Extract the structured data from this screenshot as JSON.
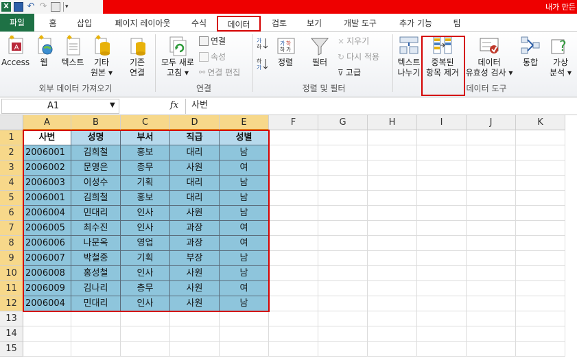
{
  "titlebar": {
    "title_text": "내가 만든"
  },
  "tabs": [
    {
      "label": "파일"
    },
    {
      "label": "홈"
    },
    {
      "label": "삽입"
    },
    {
      "label": "페이지 레이아웃"
    },
    {
      "label": "수식"
    },
    {
      "label": "데이터"
    },
    {
      "label": "검토"
    },
    {
      "label": "보기"
    },
    {
      "label": "개발 도구"
    },
    {
      "label": "추가 기능"
    },
    {
      "label": "팀"
    }
  ],
  "ribbon": {
    "access": "Access",
    "web": "웹",
    "text": "텍스트",
    "other_l1": "기타",
    "other_l2": "원본",
    "existing_l1": "기존",
    "existing_l2": "연결",
    "refresh_l1": "모두 새로",
    "refresh_l2": "고침",
    "connections": "연결",
    "properties": "속성",
    "edit_links": "연결 편집",
    "sort": "정렬",
    "filter": "필터",
    "clear": "지우기",
    "reapply": "다시 적용",
    "advanced": "고급",
    "text_to_cols_l1": "텍스트",
    "text_to_cols_l2": "나누기",
    "remove_dup_l1": "중복된",
    "remove_dup_l2": "항목 제거",
    "validation_l1": "데이터",
    "validation_l2": "유효성 검사",
    "consolidate": "통합",
    "whatif_l1": "가상",
    "whatif_l2": "분석",
    "group_external": "외부 데이터 가져오기",
    "group_connections": "연결",
    "group_sort_filter": "정렬 및 필터",
    "group_data_tools": "데이터 도구"
  },
  "formula_bar": {
    "name_box": "A1",
    "fx": "fx",
    "formula": "사번"
  },
  "columns": [
    "A",
    "B",
    "C",
    "D",
    "E",
    "F",
    "G",
    "H",
    "I",
    "J",
    "K"
  ],
  "rows": [
    "1",
    "2",
    "3",
    "4",
    "5",
    "6",
    "7",
    "8",
    "9",
    "10",
    "11",
    "12",
    "13",
    "14",
    "15"
  ],
  "table": {
    "headers": [
      "사번",
      "성명",
      "부서",
      "직급",
      "성별"
    ],
    "records": [
      [
        "2006001",
        "김희철",
        "홍보",
        "대리",
        "남"
      ],
      [
        "2006002",
        "문영은",
        "총무",
        "사원",
        "여"
      ],
      [
        "2006003",
        "이성수",
        "기획",
        "대리",
        "남"
      ],
      [
        "2006001",
        "김희철",
        "홍보",
        "대리",
        "남"
      ],
      [
        "2006004",
        "민대리",
        "인사",
        "사원",
        "남"
      ],
      [
        "2006005",
        "최수진",
        "인사",
        "과장",
        "여"
      ],
      [
        "2006006",
        "나문옥",
        "영업",
        "과장",
        "여"
      ],
      [
        "2006007",
        "박철중",
        "기획",
        "부장",
        "남"
      ],
      [
        "2006008",
        "홍성철",
        "인사",
        "사원",
        "남"
      ],
      [
        "2006009",
        "김나리",
        "총무",
        "사원",
        "여"
      ],
      [
        "2006004",
        "민대리",
        "인사",
        "사원",
        "남"
      ]
    ]
  },
  "colors": {
    "excel_green": "#1e7145",
    "highlight_red": "#d40000",
    "data_fill": "#8ec5dc",
    "selected_header": "#f7d88a"
  }
}
